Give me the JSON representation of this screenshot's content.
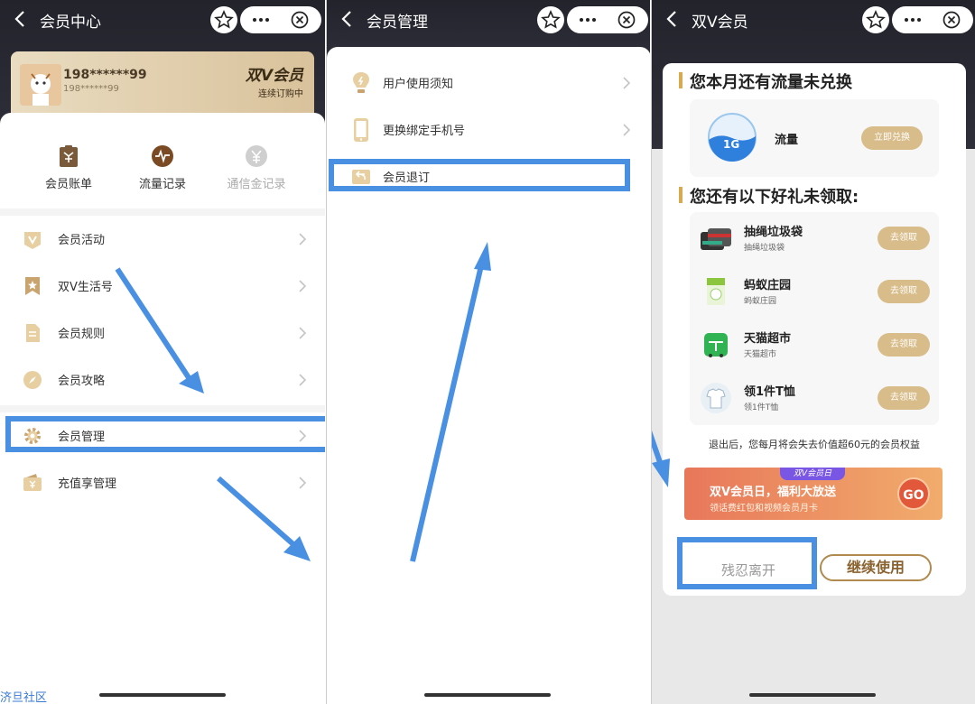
{
  "accent": "#4a90e2",
  "panels": {
    "member_center": {
      "title": "会员中心",
      "card": {
        "phone": "198******99",
        "phone_small": "198******99",
        "brand": "双V会员",
        "status": "连续订购中"
      },
      "shortcuts": [
        {
          "label": "会员账单",
          "icon": "bill-icon"
        },
        {
          "label": "流量记录",
          "icon": "traffic-record-icon"
        },
        {
          "label": "通信金记录",
          "icon": "yuan-coin-icon"
        }
      ],
      "menu": [
        {
          "label": "会员活动",
          "icon": "v-badge-icon"
        },
        {
          "label": "双V生活号",
          "icon": "star-bookmark-icon"
        },
        {
          "label": "会员规则",
          "icon": "document-icon"
        },
        {
          "label": "会员攻略",
          "icon": "compass-icon"
        },
        {
          "label": "会员管理",
          "icon": "gear-icon"
        },
        {
          "label": "充值享管理",
          "icon": "wallet-icon"
        }
      ]
    },
    "member_manage": {
      "title": "会员管理",
      "items": [
        {
          "label": "用户使用须知",
          "icon": "bulb-icon"
        },
        {
          "label": "更换绑定手机号",
          "icon": "phone-icon"
        },
        {
          "label": "会员退订",
          "icon": "return-icon"
        }
      ]
    },
    "double_v": {
      "title": "双V会员",
      "section1_title": "您本月还有流量未兑换",
      "traffic": {
        "badge": "1G",
        "label": "流量",
        "button": "立即兑换"
      },
      "section2_title": "您还有以下好礼未领取:",
      "gifts": [
        {
          "name": "抽绳垃圾袋",
          "sub": "抽绳垃圾袋",
          "button": "去领取",
          "icon": "trash-bag-icon"
        },
        {
          "name": "蚂蚁庄园",
          "sub": "蚂蚁庄园",
          "button": "去领取",
          "icon": "ant-farm-icon"
        },
        {
          "name": "天猫超市",
          "sub": "天猫超市",
          "button": "去领取",
          "icon": "tmall-market-icon"
        },
        {
          "name": "领1件T恤",
          "sub": "领1件T恤",
          "button": "去领取",
          "icon": "tshirt-icon"
        }
      ],
      "lose_notice": "退出后，您每月将会失去价值超60元的会员权益",
      "banner": {
        "tag": "双V会员日",
        "title": "双V会员日，福利大放送",
        "subtitle": "领话费红包和视频会员月卡",
        "go": "GO"
      },
      "leave_button": "残忍离开",
      "continue_button": "继续使用"
    }
  },
  "watermark": "济旦社区"
}
